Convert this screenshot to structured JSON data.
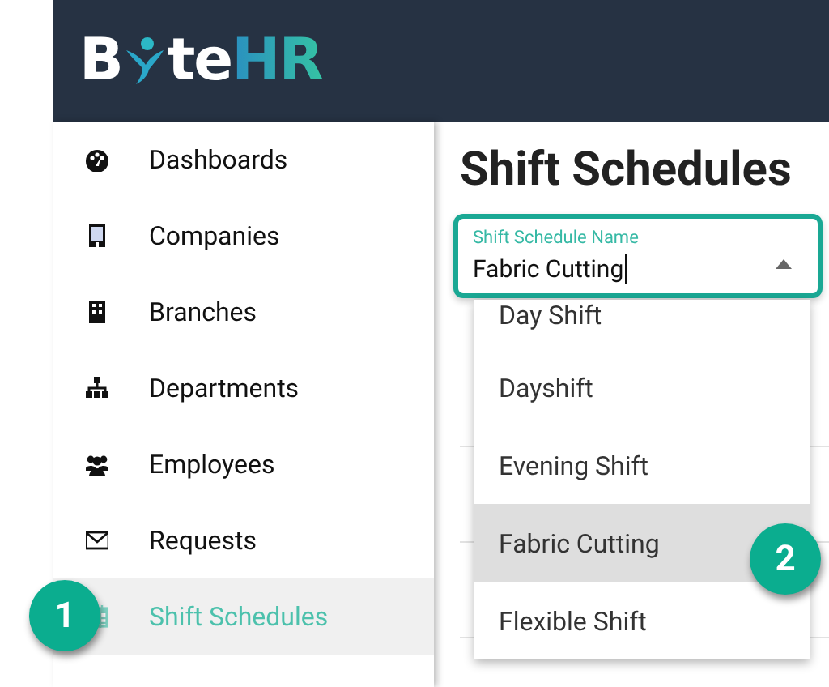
{
  "logo": {
    "lead": "B",
    "tail": "te",
    "accent": "HR"
  },
  "sidebar": {
    "items": [
      {
        "label": "Dashboards",
        "selected": false
      },
      {
        "label": "Companies",
        "selected": false
      },
      {
        "label": "Branches",
        "selected": false
      },
      {
        "label": "Departments",
        "selected": false
      },
      {
        "label": "Employees",
        "selected": false
      },
      {
        "label": "Requests",
        "selected": false
      },
      {
        "label": "Shift Schedules",
        "selected": true
      }
    ]
  },
  "page_title": "Shift Schedules",
  "field": {
    "label": "Shift Schedule Name",
    "value": "Fabric Cutting",
    "focused": true
  },
  "options": [
    {
      "label": "Day Shift",
      "selected": false
    },
    {
      "label": "Dayshift",
      "selected": false
    },
    {
      "label": "Evening Shift",
      "selected": false
    },
    {
      "label": "Fabric Cutting",
      "selected": true
    },
    {
      "label": "Flexible Shift",
      "selected": false
    }
  ],
  "callouts": [
    {
      "label": "1"
    },
    {
      "label": "2"
    }
  ]
}
